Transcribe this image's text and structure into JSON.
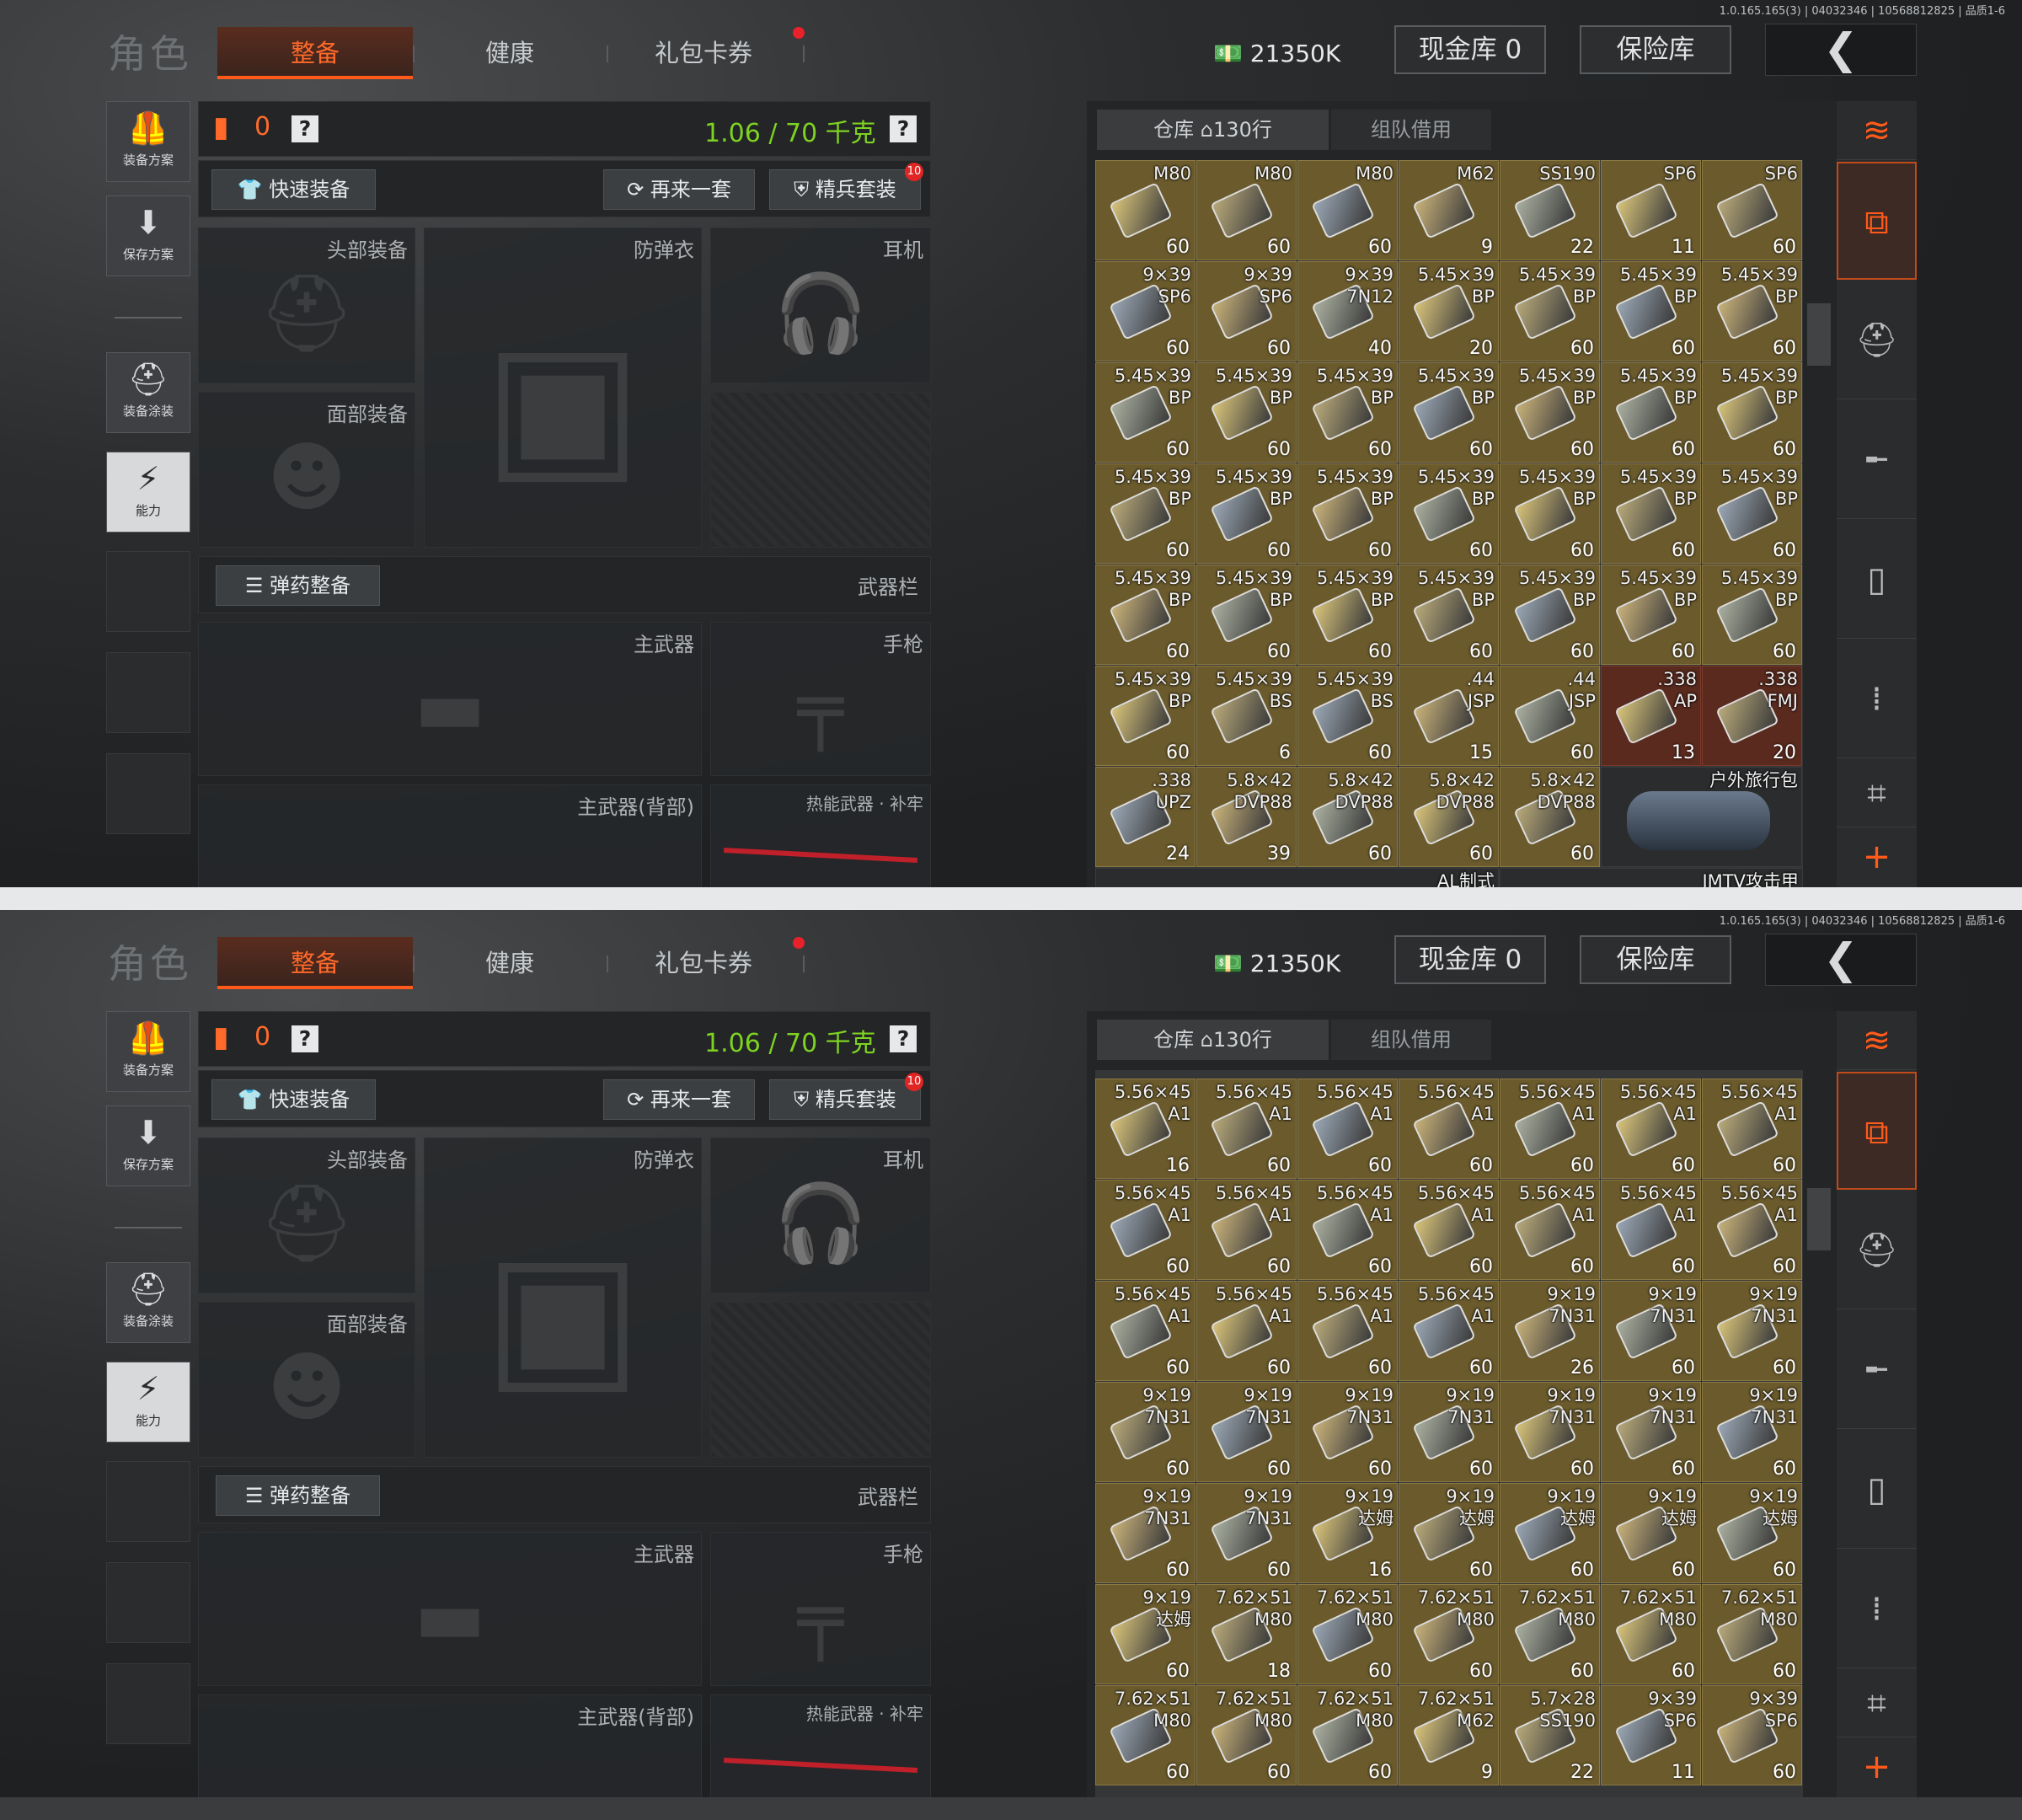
{
  "version": "1.0.165.165(3) | 04032346 | 10568812825 | 品质1-6",
  "header": {
    "title": "角色",
    "tabs": [
      "整备",
      "健康",
      "礼包卡券"
    ],
    "money": "21350K",
    "cash_vault": "现金库 0",
    "insurance": "保险库",
    "back": "❮"
  },
  "left_nav": {
    "plan": "装备方案",
    "save": "保存方案",
    "paint": "装备涂装",
    "ability": "能力"
  },
  "equipment": {
    "armor_count": "0",
    "weight": "1.06 / 70 千克",
    "quick": "快速装备",
    "again": "再来一套",
    "elite": "精兵套装",
    "elite_badge": "10",
    "ammo": "弹药整备",
    "weapon_bar": "武器栏",
    "slots": {
      "head": "头部装备",
      "vest": "防弹衣",
      "ear": "耳机",
      "face": "面部装备",
      "primary": "主武器",
      "pistol": "手枪",
      "primary_back": "主武器(背部)",
      "melee": "热能武器 · 补牢"
    }
  },
  "inventory": {
    "tab_warehouse": "仓库",
    "warehouse_count": "130行",
    "tab_team": "组队借用",
    "grid_a": [
      [
        "M80",
        "60"
      ],
      [
        "M80",
        "60"
      ],
      [
        "M80",
        "60"
      ],
      [
        "M62",
        "9"
      ],
      [
        "SS190",
        "22"
      ],
      [
        "SP6",
        "11"
      ],
      [
        "SP6",
        "60"
      ],
      [
        "9×39\nSP6",
        "60"
      ],
      [
        "9×39\nSP6",
        "60"
      ],
      [
        "9×39\n7N12",
        "40"
      ],
      [
        "5.45×39\nBP",
        "20"
      ],
      [
        "5.45×39\nBP",
        "60"
      ],
      [
        "5.45×39\nBP",
        "60"
      ],
      [
        "5.45×39\nBP",
        "60"
      ],
      [
        "5.45×39\nBP",
        "60"
      ],
      [
        "5.45×39\nBP",
        "60"
      ],
      [
        "5.45×39\nBP",
        "60"
      ],
      [
        "5.45×39\nBP",
        "60"
      ],
      [
        "5.45×39\nBP",
        "60"
      ],
      [
        "5.45×39\nBP",
        "60"
      ],
      [
        "5.45×39\nBP",
        "60"
      ],
      [
        "5.45×39\nBP",
        "60"
      ],
      [
        "5.45×39\nBP",
        "60"
      ],
      [
        "5.45×39\nBP",
        "60"
      ],
      [
        "5.45×39\nBP",
        "60"
      ],
      [
        "5.45×39\nBP",
        "60"
      ],
      [
        "5.45×39\nBP",
        "60"
      ],
      [
        "5.45×39\nBP",
        "60"
      ],
      [
        "5.45×39\nBP",
        "60"
      ],
      [
        "5.45×39\nBP",
        "60"
      ],
      [
        "5.45×39\nBP",
        "60"
      ],
      [
        "5.45×39\nBP",
        "60"
      ],
      [
        "5.45×39\nBP",
        "60"
      ],
      [
        "5.45×39\nBP",
        "60"
      ],
      [
        "5.45×39\nBP",
        "60"
      ],
      [
        "5.45×39\nBP",
        "60"
      ],
      [
        "5.45×39\nBS",
        "6"
      ],
      [
        "5.45×39\nBS",
        "60"
      ],
      [
        ".44\nJSP",
        "15"
      ],
      [
        ".44\nJSP",
        "60"
      ],
      [
        ".338\nAP",
        "13"
      ],
      [
        ".338\nFMJ",
        "20"
      ],
      [
        ".338\nUPZ",
        "24"
      ],
      [
        "5.8×42\nDVP88",
        "39"
      ],
      [
        "5.8×42\nDVP88",
        "60"
      ],
      [
        "5.8×42\nDVP88",
        "60"
      ],
      [
        "5.8×42\nDVP88",
        "60"
      ]
    ],
    "grid_a_extra": {
      "backpack": "户外旅行包",
      "al": "AL制式",
      "imtv": "IMTV攻击甲"
    },
    "grid_b": [
      [
        "5.56×45\nA1",
        "16"
      ],
      [
        "5.56×45\nA1",
        "60"
      ],
      [
        "5.56×45\nA1",
        "60"
      ],
      [
        "5.56×45\nA1",
        "60"
      ],
      [
        "5.56×45\nA1",
        "60"
      ],
      [
        "5.56×45\nA1",
        "60"
      ],
      [
        "5.56×45\nA1",
        "60"
      ],
      [
        "5.56×45\nA1",
        "60"
      ],
      [
        "5.56×45\nA1",
        "60"
      ],
      [
        "5.56×45\nA1",
        "60"
      ],
      [
        "5.56×45\nA1",
        "60"
      ],
      [
        "5.56×45\nA1",
        "60"
      ],
      [
        "5.56×45\nA1",
        "60"
      ],
      [
        "5.56×45\nA1",
        "60"
      ],
      [
        "5.56×45\nA1",
        "60"
      ],
      [
        "5.56×45\nA1",
        "60"
      ],
      [
        "5.56×45\nA1",
        "60"
      ],
      [
        "5.56×45\nA1",
        "60"
      ],
      [
        "9×19\n7N31",
        "26"
      ],
      [
        "9×19\n7N31",
        "60"
      ],
      [
        "9×19\n7N31",
        "60"
      ],
      [
        "9×19\n7N31",
        "60"
      ],
      [
        "9×19\n7N31",
        "60"
      ],
      [
        "9×19\n7N31",
        "60"
      ],
      [
        "9×19\n7N31",
        "60"
      ],
      [
        "9×19\n7N31",
        "60"
      ],
      [
        "9×19\n7N31",
        "60"
      ],
      [
        "9×19\n7N31",
        "60"
      ],
      [
        "9×19\n7N31",
        "60"
      ],
      [
        "9×19\n7N31",
        "60"
      ],
      [
        "9×19\n达姆",
        "16"
      ],
      [
        "9×19\n达姆",
        "60"
      ],
      [
        "9×19\n达姆",
        "60"
      ],
      [
        "9×19\n达姆",
        "60"
      ],
      [
        "9×19\n达姆",
        "60"
      ],
      [
        "9×19\n达姆",
        "60"
      ],
      [
        "7.62×51\nM80",
        "18"
      ],
      [
        "7.62×51\nM80",
        "60"
      ],
      [
        "7.62×51\nM80",
        "60"
      ],
      [
        "7.62×51\nM80",
        "60"
      ],
      [
        "7.62×51\nM80",
        "60"
      ],
      [
        "7.62×51\nM80",
        "60"
      ],
      [
        "7.62×51\nM80",
        "60"
      ],
      [
        "7.62×51\nM80",
        "60"
      ],
      [
        "7.62×51\nM80",
        "60"
      ],
      [
        "7.62×51\nM62",
        "9"
      ],
      [
        "5.7×28\nSS190",
        "22"
      ],
      [
        "9×39\nSP6",
        "11"
      ],
      [
        "9×39\nSP6",
        "60"
      ]
    ]
  },
  "colors": {
    "accent": "#ff5a1a",
    "weight": "#7ed321",
    "cell": "#6a5a2c"
  }
}
